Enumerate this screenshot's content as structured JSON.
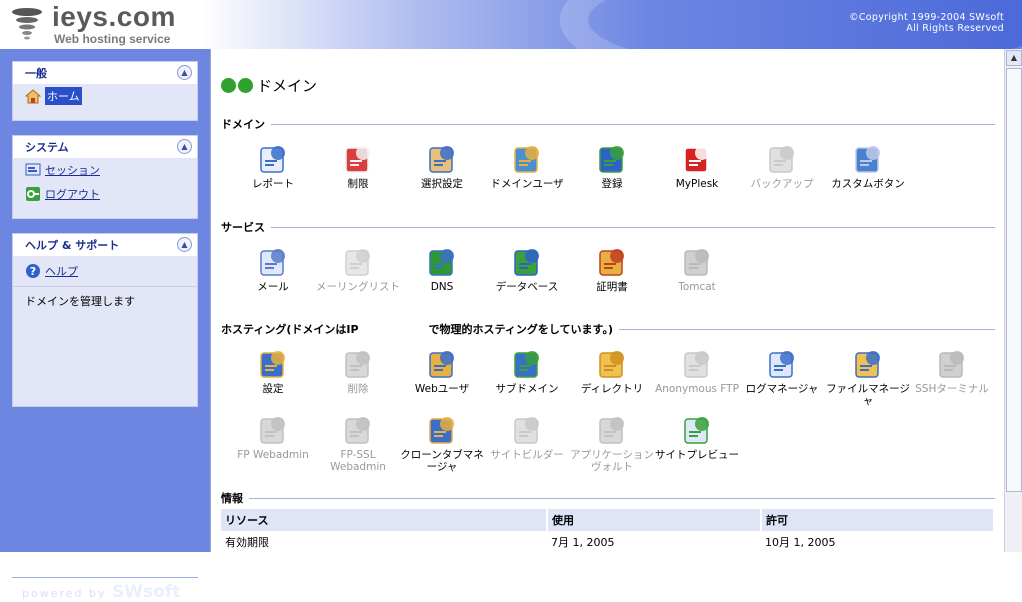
{
  "header": {
    "logo_title": "ieys.com",
    "logo_subtitle": "Web hosting service",
    "copyright_line1": "©Copyright 1999-2004 SWsoft",
    "copyright_line2": "All Rights Reserved"
  },
  "sidebar": {
    "general": {
      "title": "一般",
      "items": [
        {
          "label": "ホーム",
          "icon": "home-icon"
        }
      ]
    },
    "system": {
      "title": "システム",
      "items": [
        {
          "label": "セッション",
          "icon": "session-icon"
        },
        {
          "label": "ログアウト",
          "icon": "logout-icon"
        }
      ]
    },
    "help": {
      "title": "ヘルプ & サポート",
      "items": [
        {
          "label": "ヘルプ",
          "icon": "help-icon"
        }
      ],
      "text": "ドメインを管理します"
    },
    "powered_prefix": "powered by",
    "powered_brand": "SWsoft"
  },
  "main": {
    "page_title": "ドメイン",
    "sections": {
      "domain": {
        "title": "ドメイン",
        "tools": [
          {
            "label": "レポート",
            "icon": "report-icon",
            "enabled": true
          },
          {
            "label": "制限",
            "icon": "limits-icon",
            "enabled": true
          },
          {
            "label": "選択設定",
            "icon": "preferences-icon",
            "enabled": true
          },
          {
            "label": "ドメインユーザ",
            "icon": "domain-user-icon",
            "enabled": true
          },
          {
            "label": "登録",
            "icon": "register-icon",
            "enabled": true
          },
          {
            "label": "MyPlesk",
            "icon": "myplesk-icon",
            "enabled": true
          },
          {
            "label": "バックアップ",
            "icon": "backup-icon",
            "enabled": false
          },
          {
            "label": "カスタムボタン",
            "icon": "custom-button-icon",
            "enabled": true
          }
        ]
      },
      "services": {
        "title": "サービス",
        "tools": [
          {
            "label": "メール",
            "icon": "mail-icon",
            "enabled": true
          },
          {
            "label": "メーリングリスト",
            "icon": "mailing-list-icon",
            "enabled": false
          },
          {
            "label": "DNS",
            "icon": "dns-icon",
            "enabled": true
          },
          {
            "label": "データベース",
            "icon": "database-icon",
            "enabled": true
          },
          {
            "label": "証明書",
            "icon": "certificate-icon",
            "enabled": true
          },
          {
            "label": "Tomcat",
            "icon": "tomcat-icon",
            "enabled": false
          }
        ]
      },
      "hosting": {
        "title": "ホスティング(ドメインはIP",
        "title_suffix": "で物理的ホスティングをしています。)",
        "tools": [
          {
            "label": "設定",
            "icon": "settings-icon",
            "enabled": true
          },
          {
            "label": "削除",
            "icon": "delete-icon",
            "enabled": false
          },
          {
            "label": "Webユーザ",
            "icon": "web-user-icon",
            "enabled": true
          },
          {
            "label": "サブドメイン",
            "icon": "subdomain-icon",
            "enabled": true
          },
          {
            "label": "ディレクトリ",
            "icon": "directory-icon",
            "enabled": true
          },
          {
            "label": "Anonymous FTP",
            "icon": "anonymous-ftp-icon",
            "enabled": false
          },
          {
            "label": "ログマネージャ",
            "icon": "log-manager-icon",
            "enabled": true
          },
          {
            "label": "ファイルマネージャ",
            "icon": "file-manager-icon",
            "enabled": true
          },
          {
            "label": "SSHターミナル",
            "icon": "ssh-terminal-icon",
            "enabled": false
          },
          {
            "label": "FP Webadmin",
            "icon": "fp-webadmin-icon",
            "enabled": false
          },
          {
            "label": "FP-SSL Webadmin",
            "icon": "fp-ssl-webadmin-icon",
            "enabled": false
          },
          {
            "label": "クローンタブマネージャ",
            "icon": "crontab-icon",
            "enabled": true
          },
          {
            "label": "サイトビルダー",
            "icon": "sitebuilder-icon",
            "enabled": false
          },
          {
            "label": "アプリケーションヴォルト",
            "icon": "app-vault-icon",
            "enabled": false
          },
          {
            "label": "サイトプレビュー",
            "icon": "site-preview-icon",
            "enabled": true
          }
        ]
      },
      "info": {
        "title": "情報",
        "columns": [
          "リソース",
          "使用",
          "許可"
        ],
        "rows": [
          [
            "有効期限",
            "7月 1, 2005",
            "10月 1, 2005"
          ]
        ]
      }
    }
  },
  "colors": {
    "sidebar_bg": "#6d86e2",
    "link": "#1b2e8f",
    "selected": "#294fc9",
    "header_row": "#dfe5f7"
  }
}
